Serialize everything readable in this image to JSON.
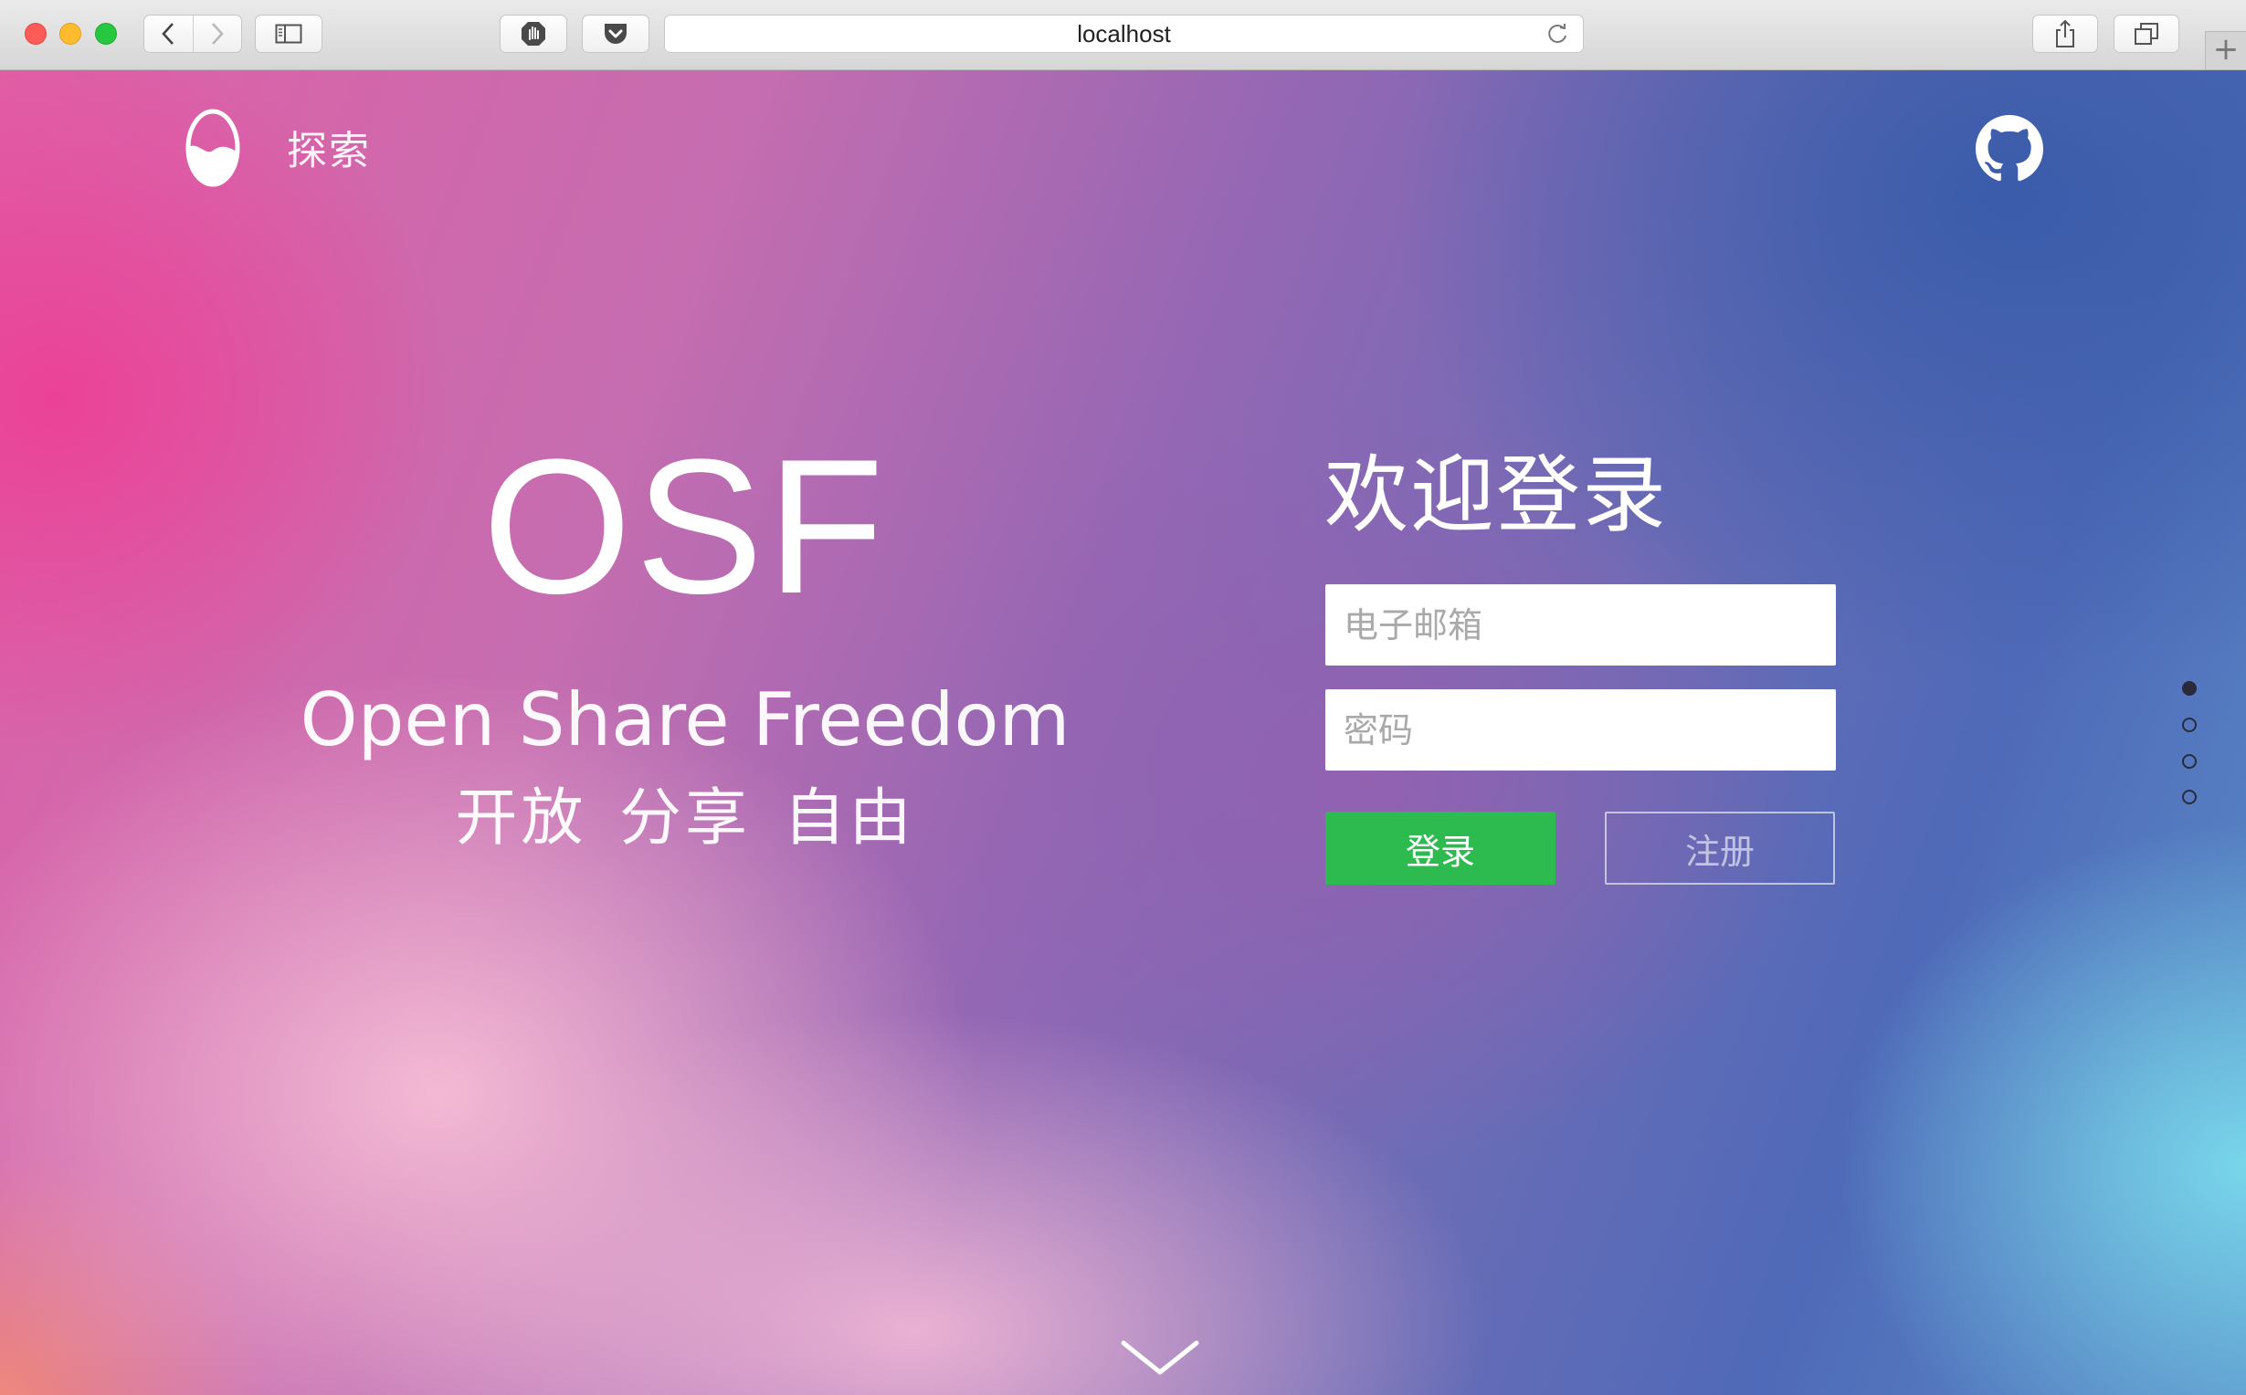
{
  "browser": {
    "url": "localhost"
  },
  "header": {
    "nav_explore": "探索"
  },
  "hero": {
    "title": "OSF",
    "subtitle": "Open Share Freedom",
    "tagline": "开放 分享 自由"
  },
  "login": {
    "title": "欢迎登录",
    "email_placeholder": "电子邮箱",
    "email_value": "",
    "password_placeholder": "密码",
    "password_value": "",
    "login_label": "登录",
    "register_label": "注册"
  },
  "pagination": {
    "count": 4,
    "active_index": 0
  },
  "colors": {
    "login_button": "#2dbb4f",
    "window_close": "#fc5b57",
    "window_minimize": "#fdbb2d",
    "window_zoom": "#27c840"
  },
  "icons": [
    "back-icon",
    "forward-icon",
    "sidebar-icon",
    "hand-icon",
    "pocket-icon",
    "reload-icon",
    "share-icon",
    "tabs-icon",
    "logo-icon",
    "github-icon",
    "chevron-down-icon"
  ]
}
